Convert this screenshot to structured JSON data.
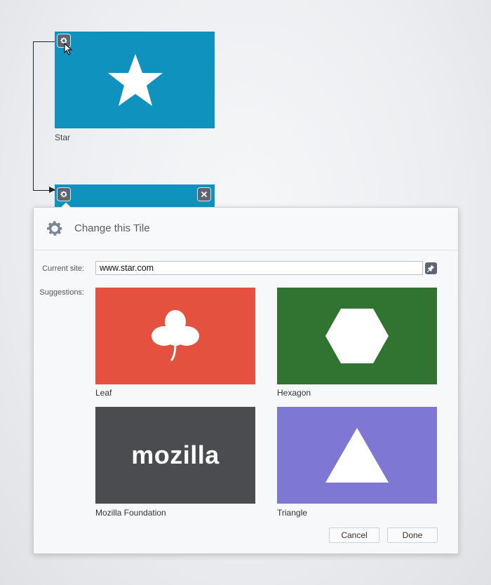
{
  "pinned_tile": {
    "caption": "Star",
    "color": "#0f93be",
    "icon": "star-icon",
    "settings_icon": "gear-icon"
  },
  "editing_tile": {
    "color": "#0f93be",
    "settings_icon": "gear-icon",
    "close_icon": "close-icon"
  },
  "dialog": {
    "title": "Change this Tile",
    "current_site_label": "Current site:",
    "current_site_value": "www.star.com",
    "suggestions_label": "Suggestions:",
    "pin_icon": "pin-icon",
    "suggestions": [
      {
        "label": "Leaf",
        "color": "#e4513e",
        "icon": "leaf-icon"
      },
      {
        "label": "Hexagon",
        "color": "#317330",
        "icon": "hexagon-icon"
      },
      {
        "label": "Mozilla Foundation",
        "color": "#4b4c50",
        "logo_text": "mozilla"
      },
      {
        "label": "Triangle",
        "color": "#7e78d4",
        "icon": "triangle-icon"
      }
    ],
    "cancel_label": "Cancel",
    "done_label": "Done"
  }
}
